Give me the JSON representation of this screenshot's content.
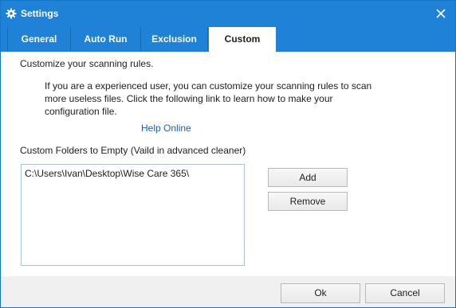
{
  "window": {
    "title": "Settings",
    "title_icon": "gear-icon",
    "close_icon": "close-icon",
    "accent_color": "#1f82d6"
  },
  "tabs": [
    {
      "label": "General",
      "active": false
    },
    {
      "label": "Auto Run",
      "active": false
    },
    {
      "label": "Exclusion",
      "active": false
    },
    {
      "label": "Custom",
      "active": true
    }
  ],
  "content": {
    "heading": "Customize your scanning rules.",
    "description": "If you are a experienced user, you can customize your scanning rules to scan more useless files. Click the following link to learn how to make your configuration file.",
    "help_link": "Help Online",
    "folders_label": "Custom Folders to Empty (Vaild in advanced cleaner)",
    "folders": [
      "C:\\Users\\Ivan\\Desktop\\Wise Care 365\\"
    ],
    "add_label": "Add",
    "remove_label": "Remove"
  },
  "footer": {
    "ok_label": "Ok",
    "cancel_label": "Cancel"
  }
}
